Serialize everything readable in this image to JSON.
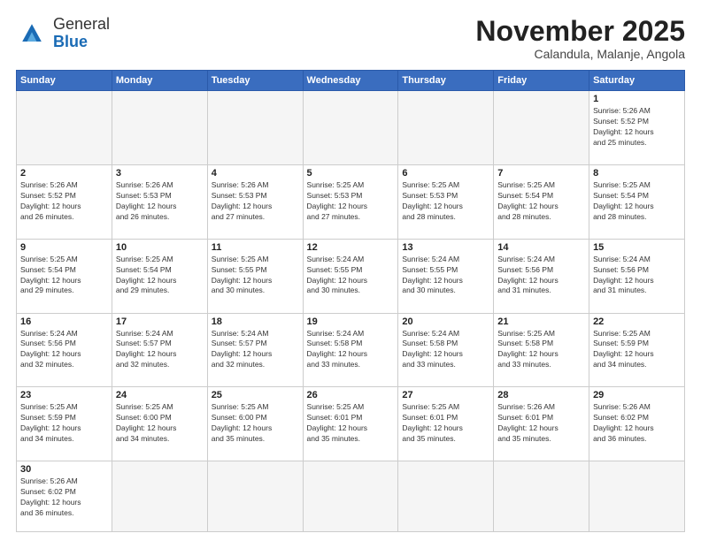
{
  "header": {
    "logo_general": "General",
    "logo_blue": "Blue",
    "month_year": "November 2025",
    "location": "Calandula, Malanje, Angola"
  },
  "weekdays": [
    "Sunday",
    "Monday",
    "Tuesday",
    "Wednesday",
    "Thursday",
    "Friday",
    "Saturday"
  ],
  "days": {
    "d1": {
      "num": "1",
      "info": "Sunrise: 5:26 AM\nSunset: 5:52 PM\nDaylight: 12 hours\nand 25 minutes."
    },
    "d2": {
      "num": "2",
      "info": "Sunrise: 5:26 AM\nSunset: 5:52 PM\nDaylight: 12 hours\nand 26 minutes."
    },
    "d3": {
      "num": "3",
      "info": "Sunrise: 5:26 AM\nSunset: 5:53 PM\nDaylight: 12 hours\nand 26 minutes."
    },
    "d4": {
      "num": "4",
      "info": "Sunrise: 5:26 AM\nSunset: 5:53 PM\nDaylight: 12 hours\nand 27 minutes."
    },
    "d5": {
      "num": "5",
      "info": "Sunrise: 5:25 AM\nSunset: 5:53 PM\nDaylight: 12 hours\nand 27 minutes."
    },
    "d6": {
      "num": "6",
      "info": "Sunrise: 5:25 AM\nSunset: 5:53 PM\nDaylight: 12 hours\nand 28 minutes."
    },
    "d7": {
      "num": "7",
      "info": "Sunrise: 5:25 AM\nSunset: 5:54 PM\nDaylight: 12 hours\nand 28 minutes."
    },
    "d8": {
      "num": "8",
      "info": "Sunrise: 5:25 AM\nSunset: 5:54 PM\nDaylight: 12 hours\nand 28 minutes."
    },
    "d9": {
      "num": "9",
      "info": "Sunrise: 5:25 AM\nSunset: 5:54 PM\nDaylight: 12 hours\nand 29 minutes."
    },
    "d10": {
      "num": "10",
      "info": "Sunrise: 5:25 AM\nSunset: 5:54 PM\nDaylight: 12 hours\nand 29 minutes."
    },
    "d11": {
      "num": "11",
      "info": "Sunrise: 5:25 AM\nSunset: 5:55 PM\nDaylight: 12 hours\nand 30 minutes."
    },
    "d12": {
      "num": "12",
      "info": "Sunrise: 5:24 AM\nSunset: 5:55 PM\nDaylight: 12 hours\nand 30 minutes."
    },
    "d13": {
      "num": "13",
      "info": "Sunrise: 5:24 AM\nSunset: 5:55 PM\nDaylight: 12 hours\nand 30 minutes."
    },
    "d14": {
      "num": "14",
      "info": "Sunrise: 5:24 AM\nSunset: 5:56 PM\nDaylight: 12 hours\nand 31 minutes."
    },
    "d15": {
      "num": "15",
      "info": "Sunrise: 5:24 AM\nSunset: 5:56 PM\nDaylight: 12 hours\nand 31 minutes."
    },
    "d16": {
      "num": "16",
      "info": "Sunrise: 5:24 AM\nSunset: 5:56 PM\nDaylight: 12 hours\nand 32 minutes."
    },
    "d17": {
      "num": "17",
      "info": "Sunrise: 5:24 AM\nSunset: 5:57 PM\nDaylight: 12 hours\nand 32 minutes."
    },
    "d18": {
      "num": "18",
      "info": "Sunrise: 5:24 AM\nSunset: 5:57 PM\nDaylight: 12 hours\nand 32 minutes."
    },
    "d19": {
      "num": "19",
      "info": "Sunrise: 5:24 AM\nSunset: 5:58 PM\nDaylight: 12 hours\nand 33 minutes."
    },
    "d20": {
      "num": "20",
      "info": "Sunrise: 5:24 AM\nSunset: 5:58 PM\nDaylight: 12 hours\nand 33 minutes."
    },
    "d21": {
      "num": "21",
      "info": "Sunrise: 5:25 AM\nSunset: 5:58 PM\nDaylight: 12 hours\nand 33 minutes."
    },
    "d22": {
      "num": "22",
      "info": "Sunrise: 5:25 AM\nSunset: 5:59 PM\nDaylight: 12 hours\nand 34 minutes."
    },
    "d23": {
      "num": "23",
      "info": "Sunrise: 5:25 AM\nSunset: 5:59 PM\nDaylight: 12 hours\nand 34 minutes."
    },
    "d24": {
      "num": "24",
      "info": "Sunrise: 5:25 AM\nSunset: 6:00 PM\nDaylight: 12 hours\nand 34 minutes."
    },
    "d25": {
      "num": "25",
      "info": "Sunrise: 5:25 AM\nSunset: 6:00 PM\nDaylight: 12 hours\nand 35 minutes."
    },
    "d26": {
      "num": "26",
      "info": "Sunrise: 5:25 AM\nSunset: 6:01 PM\nDaylight: 12 hours\nand 35 minutes."
    },
    "d27": {
      "num": "27",
      "info": "Sunrise: 5:25 AM\nSunset: 6:01 PM\nDaylight: 12 hours\nand 35 minutes."
    },
    "d28": {
      "num": "28",
      "info": "Sunrise: 5:26 AM\nSunset: 6:01 PM\nDaylight: 12 hours\nand 35 minutes."
    },
    "d29": {
      "num": "29",
      "info": "Sunrise: 5:26 AM\nSunset: 6:02 PM\nDaylight: 12 hours\nand 36 minutes."
    },
    "d30": {
      "num": "30",
      "info": "Sunrise: 5:26 AM\nSunset: 6:02 PM\nDaylight: 12 hours\nand 36 minutes."
    }
  }
}
